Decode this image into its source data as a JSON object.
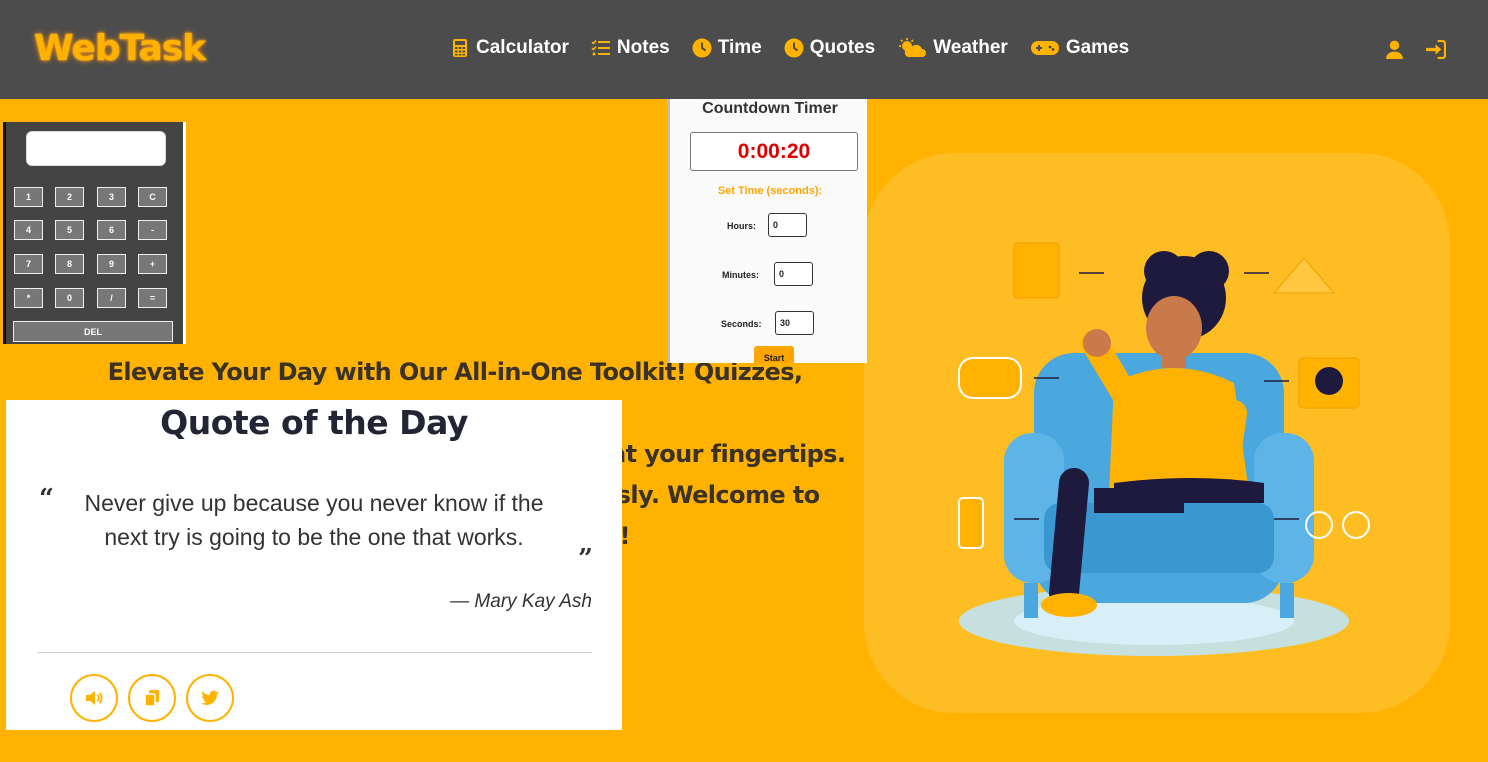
{
  "header": {
    "logo": "WebTask",
    "nav": [
      {
        "label": "Calculator",
        "icon": "calculator-icon"
      },
      {
        "label": "Notes",
        "icon": "list-icon"
      },
      {
        "label": "Time",
        "icon": "clock-icon"
      },
      {
        "label": "Quotes",
        "icon": "clock-icon"
      },
      {
        "label": "Weather",
        "icon": "cloud-sun-icon"
      },
      {
        "label": "Games",
        "icon": "gamepad-icon"
      }
    ],
    "right_icons": [
      "user-icon",
      "sign-in-icon"
    ]
  },
  "hero": {
    "line1": "Elevate Your Day with Our All-in-One Toolkit! Quizzes, calculators,",
    "line2": "at your fingertips.",
    "line3": "ssly. Welcome to",
    "line4": "n!"
  },
  "calculator": {
    "display": "",
    "keys": [
      "1",
      "2",
      "3",
      "C",
      "4",
      "5",
      "6",
      "-",
      "7",
      "8",
      "9",
      "+",
      "*",
      "0",
      "/",
      "="
    ],
    "del_label": "DEL"
  },
  "timer": {
    "title": "Countdown Timer",
    "display": "0:00:20",
    "set_label": "Set Time (seconds):",
    "hours_label": "Hours:",
    "hours_value": "0",
    "minutes_label": "Minutes:",
    "minutes_value": "0",
    "seconds_label": "Seconds:",
    "seconds_value": "30",
    "start_label": "Start"
  },
  "quote": {
    "title": "Quote of the Day",
    "open_mark": "“",
    "close_mark": "”",
    "text": "Never give up because you never know if the next try is going to be the one that works.",
    "author": "— Mary Kay Ash",
    "buttons": [
      "volume-icon",
      "copy-icon",
      "twitter-icon"
    ]
  },
  "colors": {
    "accent": "#ffb300",
    "navbar": "#4c4c4c",
    "timer_red": "#e10000"
  }
}
